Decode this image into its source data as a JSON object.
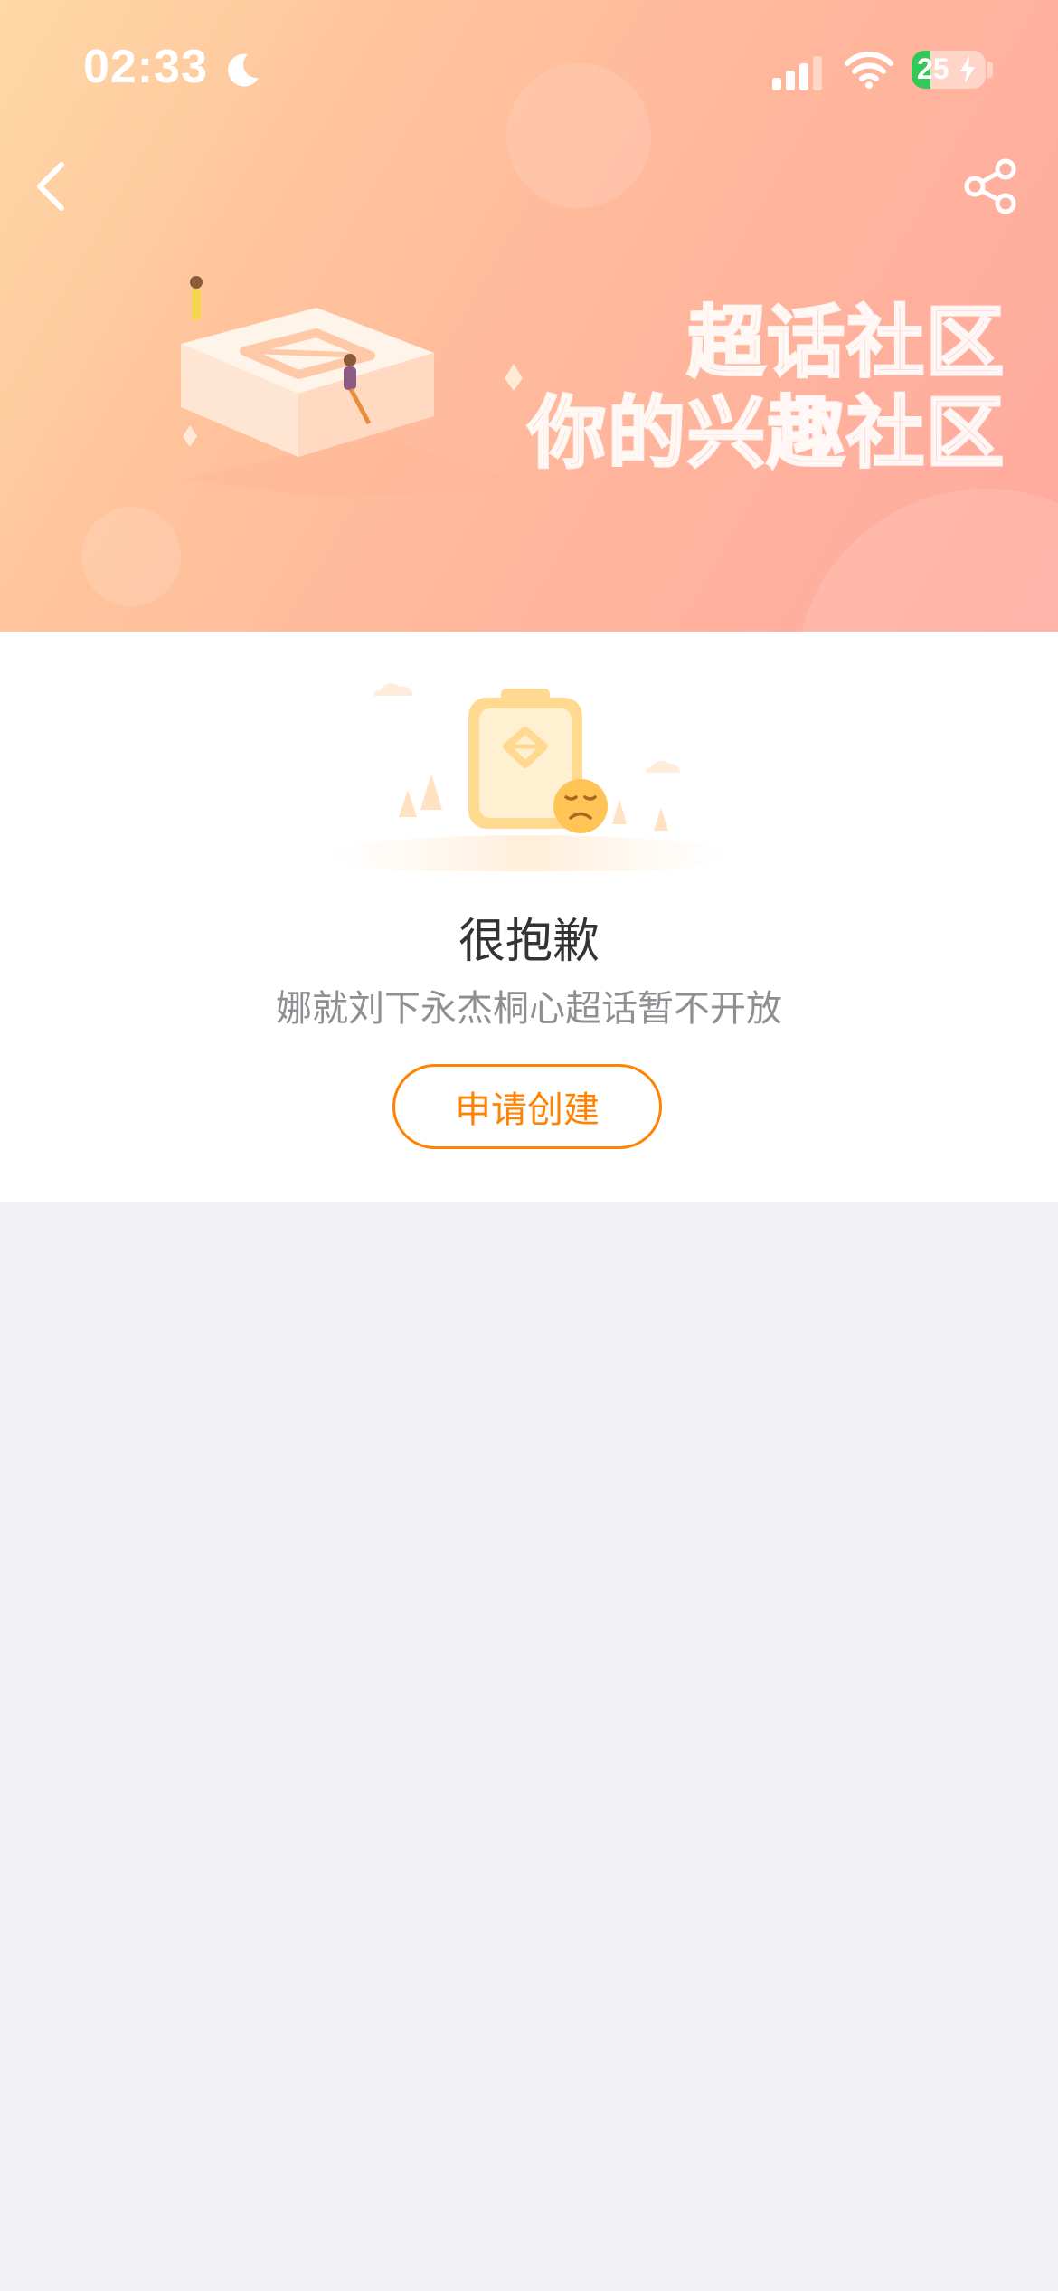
{
  "status_bar": {
    "time": "02:33",
    "battery_level": "25",
    "icons": [
      "moon-icon",
      "signal-icon",
      "wifi-icon",
      "battery-icon",
      "charging-bolt-icon"
    ]
  },
  "banner": {
    "slogan_line1": "超话社区",
    "slogan_line2": "你的兴趣社区",
    "icons": [
      "back-arrow-icon",
      "share-icon"
    ]
  },
  "empty_state": {
    "title": "很抱歉",
    "description": "娜就刘下永杰桐心超话暂不开放",
    "button_label": "申请创建"
  },
  "colors": {
    "accent": "#ff8200",
    "page_background": "#f1f1f3",
    "banner_gradient": [
      "#ffd8a6",
      "#ffa9a0"
    ]
  }
}
